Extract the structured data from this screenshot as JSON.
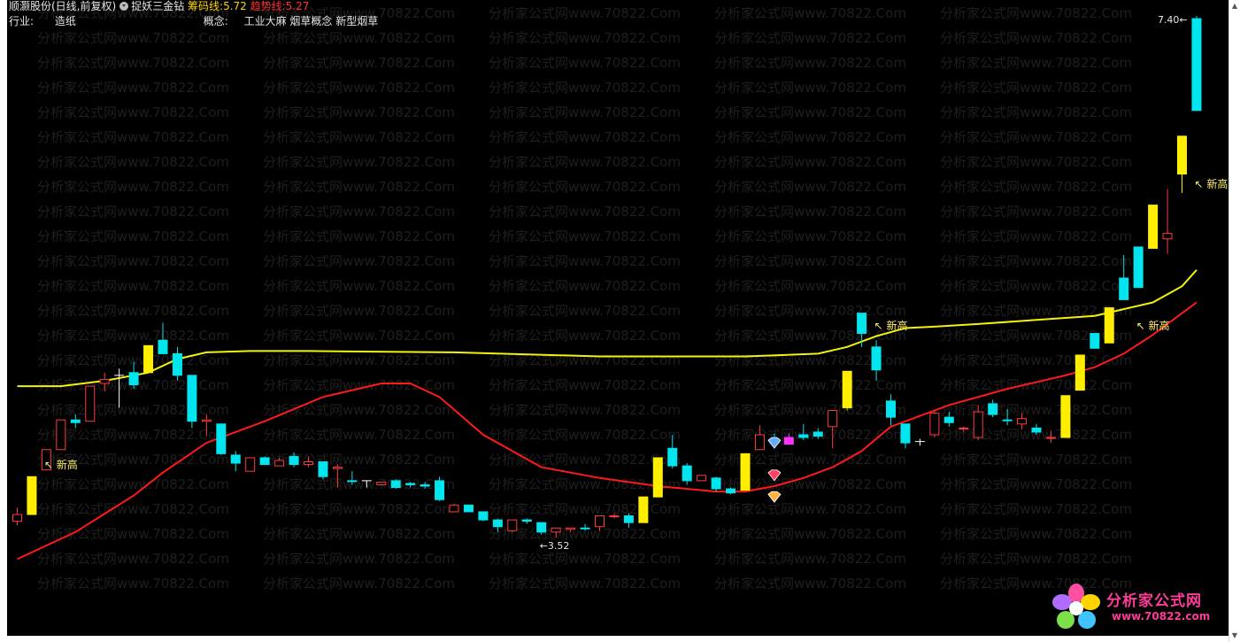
{
  "header": {
    "stock_title": "顺灏股份(日线,前复权)",
    "indicator_name": "捉妖三金钻",
    "line1_label": "筹码线:",
    "line1_value": "5.72",
    "line2_label": "趋势线:",
    "line2_value": "5.27",
    "industry_label": "行业:",
    "industry_value": "造纸",
    "concept_label": "概念:",
    "concept_value": "工业大麻 烟草概念 新型烟草"
  },
  "watermark": {
    "text": "分析家公式网www.70822.Com"
  },
  "logo": {
    "text": "分析家公式网",
    "url": "www.70822.com"
  },
  "colors": {
    "background": "#000000",
    "up_candle": "#ff3b3b",
    "down_candle": "#00e5ee",
    "signal_candle": "#ffee00",
    "chip_line": "#f2f20a",
    "trend_line": "#ff1a1a",
    "annotation": "#ffee66"
  },
  "chart_data": {
    "type": "candlestick",
    "price_range": [
      3.2,
      7.5
    ],
    "candles": [
      {
        "o": 3.71,
        "h": 3.76,
        "l": 3.63,
        "c": 3.66,
        "k": "up"
      },
      {
        "o": 3.71,
        "h": 3.99,
        "l": 3.71,
        "c": 3.99,
        "k": "sig"
      },
      {
        "o": 4.04,
        "h": 4.19,
        "l": 4.04,
        "c": 4.19,
        "k": "up"
      },
      {
        "o": 4.19,
        "h": 4.41,
        "l": 4.19,
        "c": 4.41,
        "k": "up"
      },
      {
        "o": 4.41,
        "h": 4.45,
        "l": 4.35,
        "c": 4.39,
        "k": "down"
      },
      {
        "o": 4.4,
        "h": 4.66,
        "l": 4.4,
        "c": 4.66,
        "k": "up"
      },
      {
        "o": 4.68,
        "h": 4.76,
        "l": 4.62,
        "c": 4.71,
        "k": "up"
      },
      {
        "o": 4.74,
        "h": 4.79,
        "l": 4.5,
        "c": 4.74,
        "k": "cross"
      },
      {
        "o": 4.76,
        "h": 4.84,
        "l": 4.64,
        "c": 4.67,
        "k": "down"
      },
      {
        "o": 4.76,
        "h": 4.96,
        "l": 4.76,
        "c": 4.96,
        "k": "sig"
      },
      {
        "o": 5.0,
        "h": 5.13,
        "l": 4.9,
        "c": 4.9,
        "k": "down"
      },
      {
        "o": 4.9,
        "h": 4.95,
        "l": 4.7,
        "c": 4.74,
        "k": "down"
      },
      {
        "o": 4.74,
        "h": 4.74,
        "l": 4.35,
        "c": 4.4,
        "k": "down"
      },
      {
        "o": 4.4,
        "h": 4.45,
        "l": 4.29,
        "c": 4.41,
        "k": "up"
      },
      {
        "o": 4.38,
        "h": 4.38,
        "l": 4.15,
        "c": 4.16,
        "k": "down"
      },
      {
        "o": 4.15,
        "h": 4.18,
        "l": 4.03,
        "c": 4.09,
        "k": "down"
      },
      {
        "o": 4.03,
        "h": 4.13,
        "l": 4.03,
        "c": 4.13,
        "k": "up"
      },
      {
        "o": 4.13,
        "h": 4.14,
        "l": 4.08,
        "c": 4.08,
        "k": "down"
      },
      {
        "o": 4.07,
        "h": 4.13,
        "l": 4.07,
        "c": 4.11,
        "k": "up"
      },
      {
        "o": 4.14,
        "h": 4.17,
        "l": 4.06,
        "c": 4.08,
        "k": "down"
      },
      {
        "o": 4.08,
        "h": 4.14,
        "l": 4.06,
        "c": 4.1,
        "k": "up"
      },
      {
        "o": 4.1,
        "h": 4.1,
        "l": 3.97,
        "c": 3.99,
        "k": "down"
      },
      {
        "o": 4.05,
        "h": 4.08,
        "l": 3.91,
        "c": 4.06,
        "k": "up"
      },
      {
        "o": 3.96,
        "h": 4.03,
        "l": 3.93,
        "c": 3.96,
        "k": "down"
      },
      {
        "o": 3.96,
        "h": 3.96,
        "l": 3.91,
        "c": 3.96,
        "k": "cross"
      },
      {
        "o": 3.93,
        "h": 3.95,
        "l": 3.93,
        "c": 3.95,
        "k": "up"
      },
      {
        "o": 3.96,
        "h": 3.97,
        "l": 3.9,
        "c": 3.91,
        "k": "down"
      },
      {
        "o": 3.94,
        "h": 3.95,
        "l": 3.91,
        "c": 3.93,
        "k": "down"
      },
      {
        "o": 3.93,
        "h": 3.95,
        "l": 3.9,
        "c": 3.92,
        "k": "down"
      },
      {
        "o": 3.96,
        "h": 3.99,
        "l": 3.81,
        "c": 3.82,
        "k": "down"
      },
      {
        "o": 3.73,
        "h": 3.79,
        "l": 3.73,
        "c": 3.78,
        "k": "up"
      },
      {
        "o": 3.78,
        "h": 3.78,
        "l": 3.73,
        "c": 3.73,
        "k": "down"
      },
      {
        "o": 3.73,
        "h": 3.73,
        "l": 3.66,
        "c": 3.67,
        "k": "down"
      },
      {
        "o": 3.67,
        "h": 3.68,
        "l": 3.58,
        "c": 3.62,
        "k": "down"
      },
      {
        "o": 3.59,
        "h": 3.67,
        "l": 3.58,
        "c": 3.67,
        "k": "up"
      },
      {
        "o": 3.67,
        "h": 3.68,
        "l": 3.64,
        "c": 3.66,
        "k": "down"
      },
      {
        "o": 3.65,
        "h": 3.65,
        "l": 3.56,
        "c": 3.58,
        "k": "down"
      },
      {
        "o": 3.58,
        "h": 3.61,
        "l": 3.54,
        "c": 3.61,
        "k": "up"
      },
      {
        "o": 3.6,
        "h": 3.61,
        "l": 3.58,
        "c": 3.61,
        "k": "up"
      },
      {
        "o": 3.61,
        "h": 3.64,
        "l": 3.59,
        "c": 3.61,
        "k": "down"
      },
      {
        "o": 3.62,
        "h": 3.7,
        "l": 3.59,
        "c": 3.7,
        "k": "up"
      },
      {
        "o": 3.7,
        "h": 3.72,
        "l": 3.68,
        "c": 3.7,
        "k": "up"
      },
      {
        "o": 3.7,
        "h": 3.72,
        "l": 3.61,
        "c": 3.65,
        "k": "down"
      },
      {
        "o": 3.65,
        "h": 3.84,
        "l": 3.65,
        "c": 3.84,
        "k": "sig"
      },
      {
        "o": 3.84,
        "h": 4.13,
        "l": 3.84,
        "c": 4.13,
        "k": "sig"
      },
      {
        "o": 4.2,
        "h": 4.3,
        "l": 4.05,
        "c": 4.07,
        "k": "down"
      },
      {
        "o": 4.07,
        "h": 4.09,
        "l": 3.93,
        "c": 3.96,
        "k": "down"
      },
      {
        "o": 3.96,
        "h": 4.0,
        "l": 3.96,
        "c": 4.0,
        "k": "up"
      },
      {
        "o": 3.98,
        "h": 3.99,
        "l": 3.88,
        "c": 3.9,
        "k": "down"
      },
      {
        "o": 3.9,
        "h": 3.91,
        "l": 3.86,
        "c": 3.87,
        "k": "down"
      },
      {
        "o": 3.89,
        "h": 4.16,
        "l": 3.89,
        "c": 4.16,
        "k": "sig"
      },
      {
        "o": 4.19,
        "h": 4.37,
        "l": 4.19,
        "c": 4.3,
        "k": "up"
      },
      {
        "o": 4.25,
        "h": 4.31,
        "l": 4.22,
        "c": 4.24,
        "k": "down"
      },
      {
        "o": 4.23,
        "h": 4.31,
        "l": 4.23,
        "c": 4.28,
        "k": "magenta"
      },
      {
        "o": 4.3,
        "h": 4.38,
        "l": 4.26,
        "c": 4.28,
        "k": "down"
      },
      {
        "o": 4.32,
        "h": 4.35,
        "l": 4.27,
        "c": 4.29,
        "k": "down"
      },
      {
        "o": 4.36,
        "h": 4.48,
        "l": 4.2,
        "c": 4.48,
        "k": "up"
      },
      {
        "o": 4.5,
        "h": 4.77,
        "l": 4.48,
        "c": 4.77,
        "k": "sig"
      },
      {
        "o": 5.2,
        "h": 5.2,
        "l": 4.95,
        "c": 5.05,
        "k": "down"
      },
      {
        "o": 4.95,
        "h": 5.0,
        "l": 4.7,
        "c": 4.78,
        "k": "down"
      },
      {
        "o": 4.55,
        "h": 4.6,
        "l": 4.37,
        "c": 4.43,
        "k": "down"
      },
      {
        "o": 4.38,
        "h": 4.38,
        "l": 4.2,
        "c": 4.24,
        "k": "down"
      },
      {
        "o": 4.25,
        "h": 4.27,
        "l": 4.22,
        "c": 4.25,
        "k": "cross"
      },
      {
        "o": 4.3,
        "h": 4.48,
        "l": 4.28,
        "c": 4.46,
        "k": "up"
      },
      {
        "o": 4.43,
        "h": 4.47,
        "l": 4.36,
        "c": 4.39,
        "k": "down"
      },
      {
        "o": 4.35,
        "h": 4.36,
        "l": 4.32,
        "c": 4.35,
        "k": "up"
      },
      {
        "o": 4.28,
        "h": 4.52,
        "l": 4.26,
        "c": 4.47,
        "k": "up"
      },
      {
        "o": 4.53,
        "h": 4.56,
        "l": 4.43,
        "c": 4.45,
        "k": "down"
      },
      {
        "o": 4.41,
        "h": 4.49,
        "l": 4.37,
        "c": 4.41,
        "k": "down"
      },
      {
        "o": 4.38,
        "h": 4.46,
        "l": 4.34,
        "c": 4.42,
        "k": "up"
      },
      {
        "o": 4.35,
        "h": 4.38,
        "l": 4.3,
        "c": 4.32,
        "k": "down"
      },
      {
        "o": 4.28,
        "h": 4.33,
        "l": 4.24,
        "c": 4.28,
        "k": "up"
      },
      {
        "o": 4.28,
        "h": 4.59,
        "l": 4.28,
        "c": 4.59,
        "k": "sig"
      },
      {
        "o": 4.63,
        "h": 4.89,
        "l": 4.63,
        "c": 4.89,
        "k": "sig"
      },
      {
        "o": 4.94,
        "h": 5.05,
        "l": 4.94,
        "c": 5.05,
        "k": "down"
      },
      {
        "o": 4.98,
        "h": 5.24,
        "l": 4.98,
        "c": 5.24,
        "k": "sig"
      },
      {
        "o": 5.46,
        "h": 5.63,
        "l": 5.3,
        "c": 5.3,
        "k": "down"
      },
      {
        "o": 5.39,
        "h": 5.69,
        "l": 5.39,
        "c": 5.69,
        "k": "down"
      },
      {
        "o": 5.68,
        "h": 6.0,
        "l": 5.68,
        "c": 6.0,
        "k": "sig"
      },
      {
        "o": 5.75,
        "h": 6.12,
        "l": 5.64,
        "c": 5.79,
        "k": "up"
      },
      {
        "o": 6.51,
        "h": 6.51,
        "l": 6.09,
        "c": 6.23,
        "k": "sig"
      },
      {
        "o": 7.38,
        "h": 7.4,
        "l": 6.7,
        "c": 6.7,
        "k": "down"
      }
    ],
    "chip_line_points": [
      [
        0,
        4.66
      ],
      [
        3,
        4.66
      ],
      [
        6,
        4.7
      ],
      [
        9,
        4.76
      ],
      [
        11,
        4.86
      ],
      [
        13,
        4.91
      ],
      [
        16,
        4.92
      ],
      [
        20,
        4.92
      ],
      [
        30,
        4.91
      ],
      [
        40,
        4.88
      ],
      [
        50,
        4.88
      ],
      [
        55,
        4.9
      ],
      [
        57,
        4.95
      ],
      [
        59,
        5.03
      ],
      [
        61,
        5.09
      ],
      [
        63,
        5.1
      ],
      [
        66,
        5.12
      ],
      [
        70,
        5.15
      ],
      [
        74,
        5.18
      ],
      [
        78,
        5.28
      ],
      [
        80,
        5.4
      ],
      [
        81,
        5.52
      ]
    ],
    "trend_line_points": [
      [
        0,
        3.38
      ],
      [
        4,
        3.58
      ],
      [
        8,
        3.85
      ],
      [
        10,
        4.02
      ],
      [
        13,
        4.24
      ],
      [
        17,
        4.4
      ],
      [
        21,
        4.58
      ],
      [
        25,
        4.68
      ],
      [
        27,
        4.68
      ],
      [
        29,
        4.58
      ],
      [
        32,
        4.3
      ],
      [
        36,
        4.06
      ],
      [
        40,
        3.98
      ],
      [
        44,
        3.92
      ],
      [
        48,
        3.88
      ],
      [
        50,
        3.88
      ],
      [
        52,
        3.92
      ],
      [
        54,
        3.98
      ],
      [
        56,
        4.06
      ],
      [
        58,
        4.18
      ],
      [
        60,
        4.36
      ],
      [
        64,
        4.52
      ],
      [
        68,
        4.64
      ],
      [
        72,
        4.74
      ],
      [
        74,
        4.8
      ],
      [
        76,
        4.9
      ],
      [
        78,
        5.04
      ],
      [
        80,
        5.2
      ],
      [
        81,
        5.28
      ]
    ],
    "annotations": [
      {
        "index": 1,
        "text": "↖ 新高",
        "price": 4.05
      },
      {
        "index": 58,
        "text": "↖ 新高",
        "price": 5.08
      },
      {
        "index": 76,
        "text": "↖ 新高",
        "price": 5.08
      },
      {
        "index": 80,
        "text": "↖ 新高",
        "price": 6.13
      }
    ],
    "low_label": {
      "index": 36,
      "text": "←3.52",
      "price": 3.52
    },
    "high_label": {
      "index": 81,
      "text": "7.40←",
      "price": 7.4
    },
    "diamonds": [
      {
        "index": 52,
        "price": 4.24,
        "color": "#66aaff"
      },
      {
        "index": 52,
        "price": 4.0,
        "color": "#ff4060"
      },
      {
        "index": 52,
        "price": 3.84,
        "color": "#ffb040"
      }
    ]
  }
}
